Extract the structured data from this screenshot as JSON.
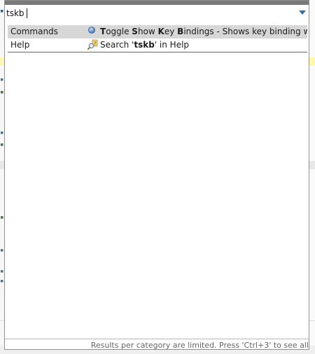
{
  "search": {
    "query": "tskb",
    "placeholder": ""
  },
  "results": [
    {
      "category": "Commands",
      "icon": "command-icon",
      "title_segments": [
        {
          "text": "T",
          "bold": true
        },
        {
          "text": "oggle ",
          "bold": false
        },
        {
          "text": "S",
          "bold": true
        },
        {
          "text": "how ",
          "bold": false
        },
        {
          "text": "K",
          "bold": true
        },
        {
          "text": "ey ",
          "bold": false
        },
        {
          "text": "B",
          "bold": true
        },
        {
          "text": "indings - Shows key binding when co",
          "bold": false
        }
      ],
      "selected": true
    },
    {
      "category": "Help",
      "icon": "help-search-icon",
      "title_segments": [
        {
          "text": "Search '",
          "bold": false
        },
        {
          "text": "tskb",
          "bold": true
        },
        {
          "text": "' in Help",
          "bold": false
        }
      ],
      "selected": false
    }
  ],
  "footer": {
    "status": "Results per category are limited. Press 'Ctrl+3' to see all"
  },
  "colors": {
    "selection": "#d7d7d7",
    "dropdown_arrow": "#2d6fa6",
    "top_bar": "#7a7a7a"
  }
}
